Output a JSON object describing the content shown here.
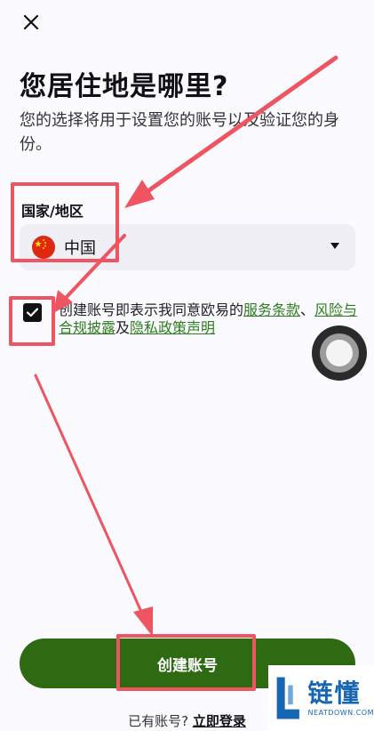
{
  "header": {
    "close_icon": "close-icon"
  },
  "page": {
    "title": "您居住地是哪里?",
    "subtitle": "您的选择将用于设置您的账号以及验证您的身份。"
  },
  "country_field": {
    "label": "国家/地区",
    "value": "中国",
    "flag_icon": "china-flag-icon",
    "dropdown_icon": "caret-down-icon"
  },
  "agreement": {
    "checked": true,
    "prefix": "创建账号即表示我同意欧易的",
    "terms_link": "服务条款",
    "separator": "、",
    "risk_link": "风险与合规披露",
    "conjunction": "及",
    "privacy_link": "隐私政策声明",
    "link_color": "#2e7d1f"
  },
  "primary_button": {
    "label": "创建账号",
    "color": "#2d6a12"
  },
  "footer": {
    "have_account_text": "已有账号? ",
    "login_link": "立即登录"
  },
  "watermark": {
    "name_cn": "链懂",
    "name_en": "NEATDOWN.COM"
  },
  "annotation_color": "#ee5560"
}
